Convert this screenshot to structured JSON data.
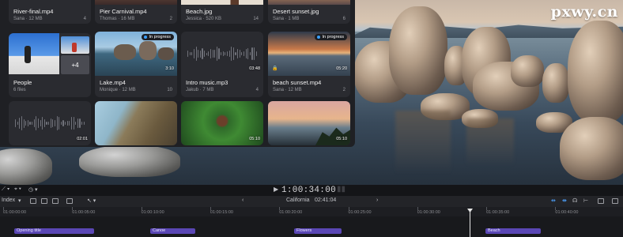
{
  "watermark": "pxwy.cn",
  "tiles": [
    {
      "name": "River-final.mp4",
      "meta": "Sana · 12 MB",
      "count": "4"
    },
    {
      "name": "Pier Carnival.mp4",
      "meta": "Thomas · 16 MB",
      "count": "2"
    },
    {
      "name": "Beach.jpg",
      "meta": "Jessica · 520 KB",
      "count": "14"
    },
    {
      "name": "Desert sunset.jpg",
      "meta": "Sana · 1 MB",
      "count": "6"
    },
    {
      "name": "People",
      "meta": "6 files",
      "more": "+4"
    },
    {
      "name": "Lake.mp4",
      "meta": "Monique · 12 MB",
      "count": "10",
      "duration": "3:10",
      "status": "In progress"
    },
    {
      "name": "Intro music.mp3",
      "meta": "Jakub · 7 MB",
      "count": "4",
      "duration": "03:48"
    },
    {
      "name": "beach sunset.mp4",
      "meta": "Sana · 12 MB",
      "count": "2",
      "duration": "05:20",
      "status": "In progress"
    },
    {
      "duration": "02:01"
    },
    {},
    {
      "duration": "05:10"
    },
    {
      "duration": "05:10"
    }
  ],
  "transport": {
    "timecode": "1:00:34:00"
  },
  "timeline": {
    "index_label": "Index",
    "project_name": "California",
    "project_duration": "02:41:04",
    "ruler_labels": [
      "01:00:00:00",
      "01:00:05:00",
      "01:00:10:00",
      "01:00:15:00",
      "01:00:20:00",
      "01:00:25:00",
      "01:00:30:00",
      "01:00:35:00",
      "01:00:40:00"
    ],
    "clips": [
      "Opening title",
      "Canoe",
      "Flowers",
      "Beach"
    ],
    "clip_color": "#5a47b5"
  }
}
